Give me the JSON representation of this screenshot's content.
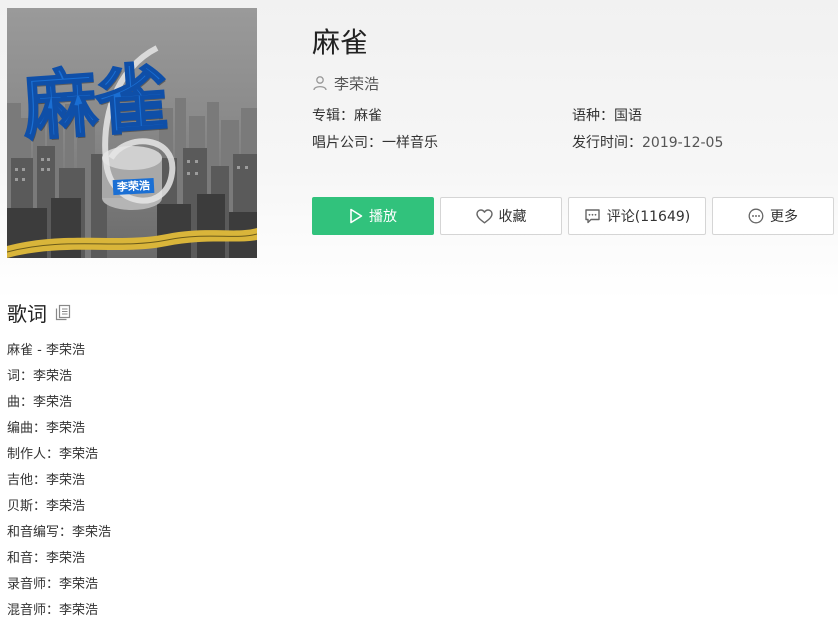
{
  "cover": {
    "title_art": "麻雀",
    "artist_art": "李荣浩",
    "accent_color": "#1a6fd4"
  },
  "song": {
    "title": "麻雀",
    "artist": "李荣浩"
  },
  "meta": {
    "album_label": "专辑：",
    "album_value": "麻雀",
    "language_label": "语种：",
    "language_value": "国语",
    "label_label": "唱片公司：",
    "label_value": "一样音乐",
    "release_label": "发行时间：",
    "release_value": "2019-12-05"
  },
  "actions": {
    "play": {
      "label": "播放",
      "icon": "play-icon",
      "color": "#31c27c"
    },
    "favorite": {
      "label": "收藏",
      "icon": "heart-icon"
    },
    "comment": {
      "label": "评论(11649)",
      "icon": "comment-icon"
    },
    "more": {
      "label": "更多",
      "icon": "more-icon"
    }
  },
  "lyrics": {
    "heading": "歌词",
    "copy_icon": "copy-icon",
    "lines": [
      "麻雀 - 李荣浩",
      "词：李荣浩",
      "曲：李荣浩",
      "编曲：李荣浩",
      "制作人：李荣浩",
      "吉他：李荣浩",
      "贝斯：李荣浩",
      "和音编写：李荣浩",
      "和音：李荣浩",
      "录音师：李荣浩",
      "混音师：李荣浩"
    ]
  }
}
